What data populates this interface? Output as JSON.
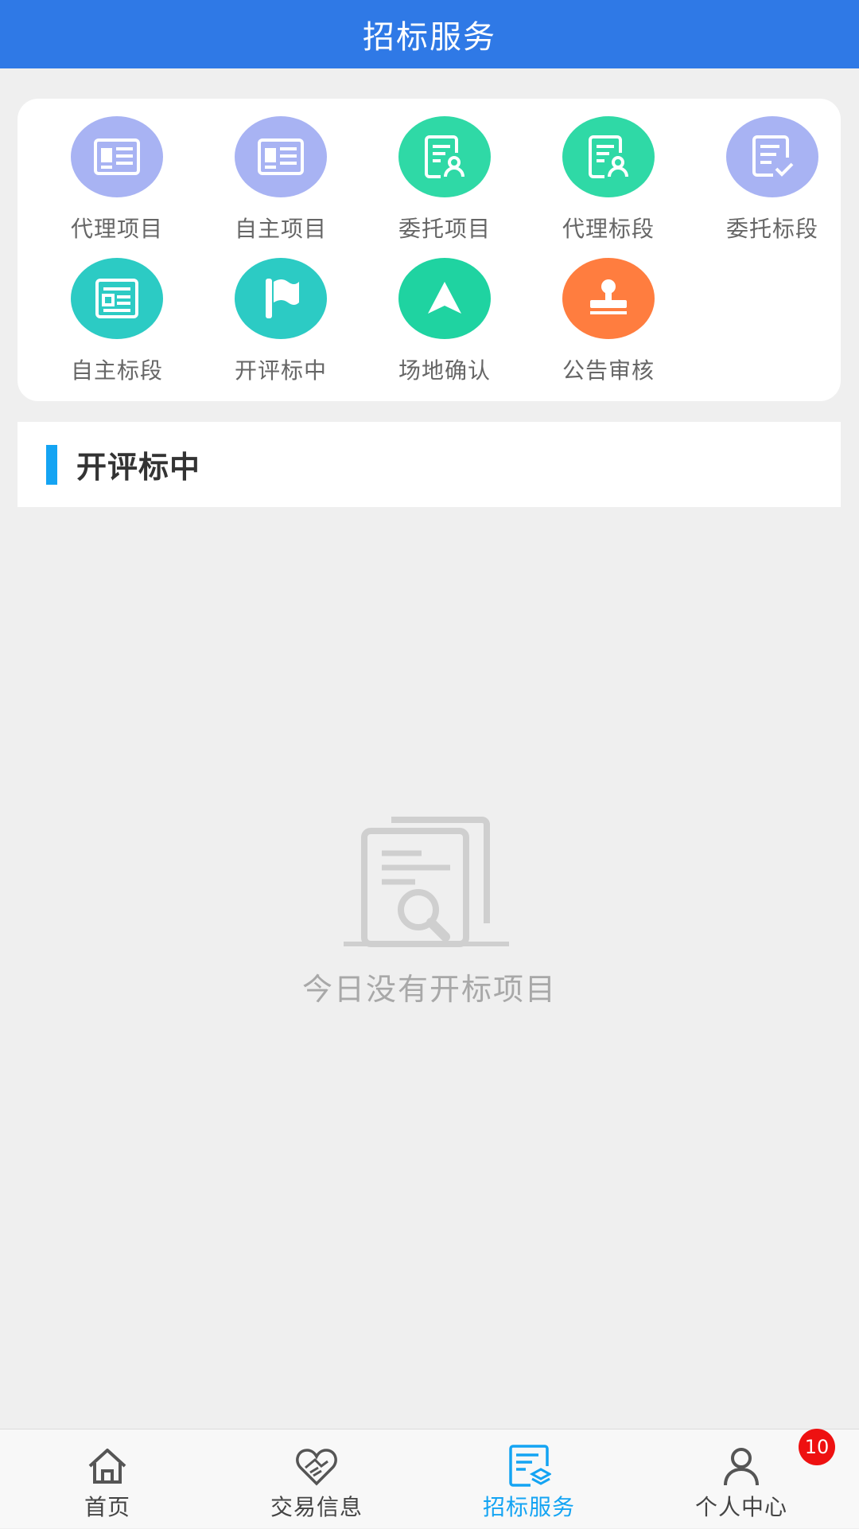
{
  "header": {
    "title": "招标服务"
  },
  "menu": {
    "items": [
      {
        "label": "代理项目",
        "icon": "newspaper-icon",
        "color": "#a8b3f3"
      },
      {
        "label": "自主项目",
        "icon": "newspaper-icon",
        "color": "#a8b3f3"
      },
      {
        "label": "委托项目",
        "icon": "document-user-icon",
        "color": "#2fd9a6"
      },
      {
        "label": "代理标段",
        "icon": "document-user-icon",
        "color": "#2fd9a6"
      },
      {
        "label": "委托标段",
        "icon": "document-check-icon",
        "color": "#a8b3f3"
      },
      {
        "label": "自主标段",
        "icon": "form-icon",
        "color": "#2ccbc4"
      },
      {
        "label": "开评标中",
        "icon": "flag-icon",
        "color": "#2ccbc4"
      },
      {
        "label": "场地确认",
        "icon": "navigation-arrow-icon",
        "color": "#1fd3a1"
      },
      {
        "label": "公告审核",
        "icon": "stamp-icon",
        "color": "#ff7d3f"
      }
    ]
  },
  "section": {
    "title": "开评标中",
    "accent": "#14a4f3"
  },
  "empty": {
    "text": "今日没有开标项目",
    "icon": "document-search-icon"
  },
  "tabbar": {
    "tabs": [
      {
        "label": "首页",
        "icon": "home-icon"
      },
      {
        "label": "交易信息",
        "icon": "handshake-heart-icon"
      },
      {
        "label": "招标服务",
        "icon": "bid-documents-icon",
        "active": true
      },
      {
        "label": "个人中心",
        "icon": "user-icon"
      }
    ],
    "badge": "10"
  }
}
